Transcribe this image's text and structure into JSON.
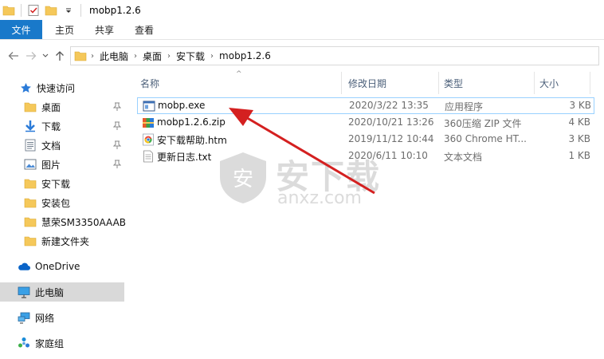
{
  "window": {
    "title": "mobp1.2.6"
  },
  "ribbon": {
    "tabs": [
      "文件",
      "主页",
      "共享",
      "查看"
    ]
  },
  "address": {
    "crumbs": [
      "此电脑",
      "桌面",
      "安下载",
      "mobp1.2.6"
    ]
  },
  "sidebar": {
    "quick_access": "快速访问",
    "items": [
      {
        "label": "桌面",
        "icon": "folder-icon",
        "pinned": true
      },
      {
        "label": "下载",
        "icon": "download-icon",
        "pinned": true
      },
      {
        "label": "文档",
        "icon": "document-icon",
        "pinned": true
      },
      {
        "label": "图片",
        "icon": "picture-icon",
        "pinned": true
      },
      {
        "label": "安下载",
        "icon": "folder-icon",
        "pinned": false
      },
      {
        "label": "安装包",
        "icon": "folder-icon",
        "pinned": false
      },
      {
        "label": "慧荣SM3350AAAB",
        "icon": "folder-icon",
        "pinned": false
      },
      {
        "label": "新建文件夹",
        "icon": "folder-icon",
        "pinned": false
      }
    ],
    "onedrive": "OneDrive",
    "this_pc": "此电脑",
    "network": "网络",
    "homegroup": "家庭组"
  },
  "columns": {
    "name": "名称",
    "modified": "修改日期",
    "type": "类型",
    "size": "大小"
  },
  "files": [
    {
      "name": "mobp.exe",
      "modified": "2020/3/22 13:35",
      "type": "应用程序",
      "size": "3 KB",
      "icon": "exe-icon",
      "selected": true
    },
    {
      "name": "mobp1.2.6.zip",
      "modified": "2020/10/21 13:26",
      "type": "360压缩 ZIP 文件",
      "size": "4 KB",
      "icon": "zip-icon",
      "selected": false
    },
    {
      "name": "安下载帮助.htm",
      "modified": "2019/11/12 10:44",
      "type": "360 Chrome HT...",
      "size": "3 KB",
      "icon": "chrome-html-icon",
      "selected": false
    },
    {
      "name": "更新日志.txt",
      "modified": "2020/6/11 10:10",
      "type": "文本文档",
      "size": "1 KB",
      "icon": "text-file-icon",
      "selected": false
    }
  ],
  "watermark": {
    "line1": "安下载",
    "line2": "anxz.com",
    "badge": "安"
  },
  "colors": {
    "accent": "#1979ca",
    "selection_border": "#99d1ff",
    "arrow": "#d42020",
    "folder": "#f5c85a"
  }
}
